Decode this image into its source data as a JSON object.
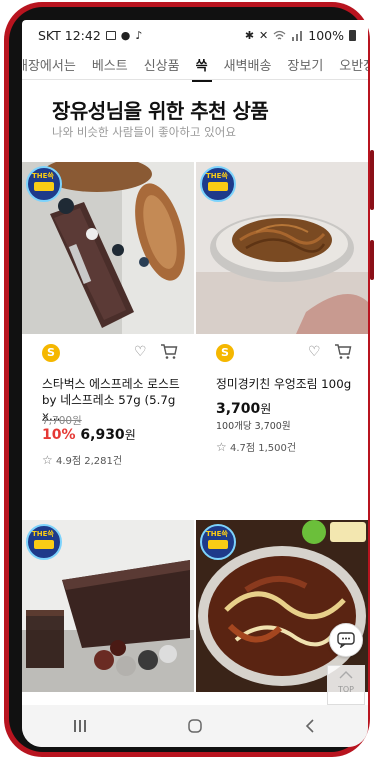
{
  "status": {
    "carrier_time": "SKT 12:42",
    "battery": "100%"
  },
  "categories": [
    "매장에서는",
    "베스트",
    "신상품",
    "쓱",
    "새벽배송",
    "장보기",
    "오반장"
  ],
  "active_category": "쓱",
  "section": {
    "title": "장유성님을 위한 추천 상품",
    "subtitle": "나와 비슷한 사람들이 좋아하고 있어요"
  },
  "badge_text": "THE쓱",
  "coin_symbol": "S",
  "products": [
    {
      "name": "스타벅스 에스프레소 로스트 by 네스프레소 57g (5.7g x...",
      "original_price": "7,700원",
      "discount": "10%",
      "price": "6,930",
      "won": "원",
      "unit_price": "",
      "rating": "4.9점 2,281건"
    },
    {
      "name": "정미경키친 우엉조림 100g",
      "original_price": "",
      "discount": "",
      "price": "3,700",
      "won": "원",
      "unit_price": "100개당 3,700원",
      "rating": "4.7점 1,500건"
    }
  ],
  "floating": {
    "top_label": "TOP"
  },
  "colors": {
    "accent_red": "#e53935",
    "coin": "#f5b700",
    "phone": "#b8141f"
  },
  "icons": [
    "photo-icon",
    "chat-bubble-icon",
    "vibrate-icon",
    "bluetooth-icon",
    "mute-icon",
    "wifi-icon",
    "signal-icon",
    "battery-icon",
    "heart-icon",
    "cart-icon",
    "chat-icon",
    "chevron-up-icon",
    "recents-icon",
    "home-icon",
    "back-icon"
  ]
}
